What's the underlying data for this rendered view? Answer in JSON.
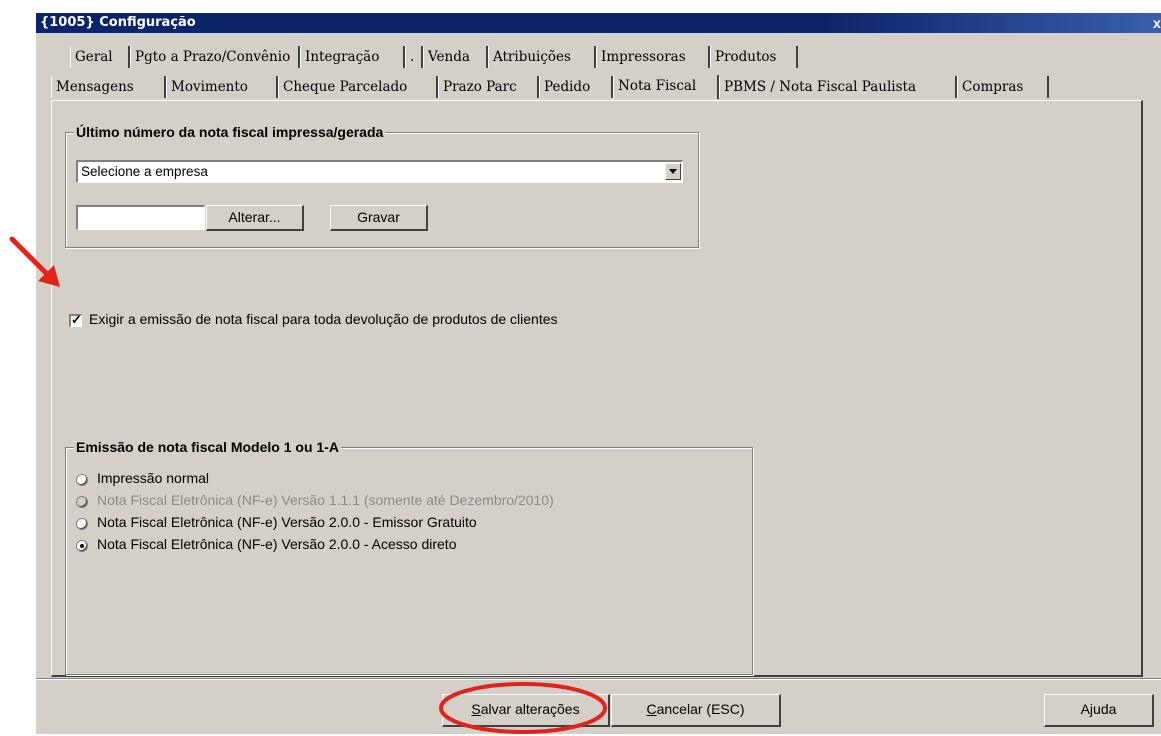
{
  "window": {
    "title": "{1005} Configuração",
    "close_glyph": "x"
  },
  "tabs_row1": [
    "Geral",
    "Pgto a Prazo/Convênio",
    "Integração",
    ".",
    "Venda",
    "Atribuições",
    "Impressoras",
    "Produtos"
  ],
  "tabs_row2": [
    "Mensagens",
    "Movimento",
    "Cheque Parcelado",
    "Prazo Parc",
    "Pedido",
    "Nota Fiscal",
    "PBMS / Nota Fiscal Paulista",
    "Compras"
  ],
  "active_tab": "Nota Fiscal",
  "last_number_group": {
    "legend": "Último número da nota fiscal impressa/gerada",
    "company_select_value": "Selecione a empresa",
    "number_value": "",
    "alter_label": "Alterar...",
    "save_label": "Gravar"
  },
  "devolucao_checkbox": {
    "checked": true,
    "label": "Exigir a emissão de nota fiscal para toda devolução de produtos de clientes"
  },
  "emissao_group": {
    "legend": "Emissão de nota fiscal Modelo 1 ou 1-A",
    "options": [
      {
        "label": "Impressão normal",
        "selected": false,
        "disabled": false
      },
      {
        "label": "Nota Fiscal Eletrônica (NF-e) Versão 1.1.1 (somente até Dezembro/2010)",
        "selected": false,
        "disabled": true
      },
      {
        "label": "Nota Fiscal Eletrônica (NF-e) Versão 2.0.0 - Emissor Gratuito",
        "selected": false,
        "disabled": false
      },
      {
        "label": "Nota Fiscal Eletrônica (NF-e) Versão 2.0.0 - Acesso direto",
        "selected": true,
        "disabled": false
      }
    ]
  },
  "buttons": {
    "save_first": "S",
    "save_rest": "alvar alterações",
    "cancel_first": "C",
    "cancel_rest": "ancelar (ESC)",
    "help": "Ajuda"
  },
  "annotations": {
    "arrow_color": "#e0241c",
    "oval_color": "#e0241c"
  }
}
